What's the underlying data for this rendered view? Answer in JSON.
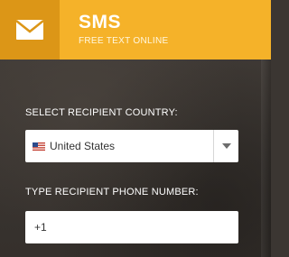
{
  "header": {
    "icon": "envelope-icon",
    "title": "SMS",
    "subtitle": "FREE TEXT ONLINE"
  },
  "form": {
    "country_label": "SELECT RECIPIENT COUNTRY:",
    "country_select": {
      "flag_icon": "us-flag-icon",
      "selected": "United States",
      "dropdown_icon": "chevron-down-icon"
    },
    "phone_label": "TYPE RECIPIENT PHONE NUMBER:",
    "phone_value": "+1"
  },
  "colors": {
    "header": "#f5b229",
    "icon_box": "#dc9617",
    "background": "#3b3632",
    "text_light": "#ffffff"
  }
}
